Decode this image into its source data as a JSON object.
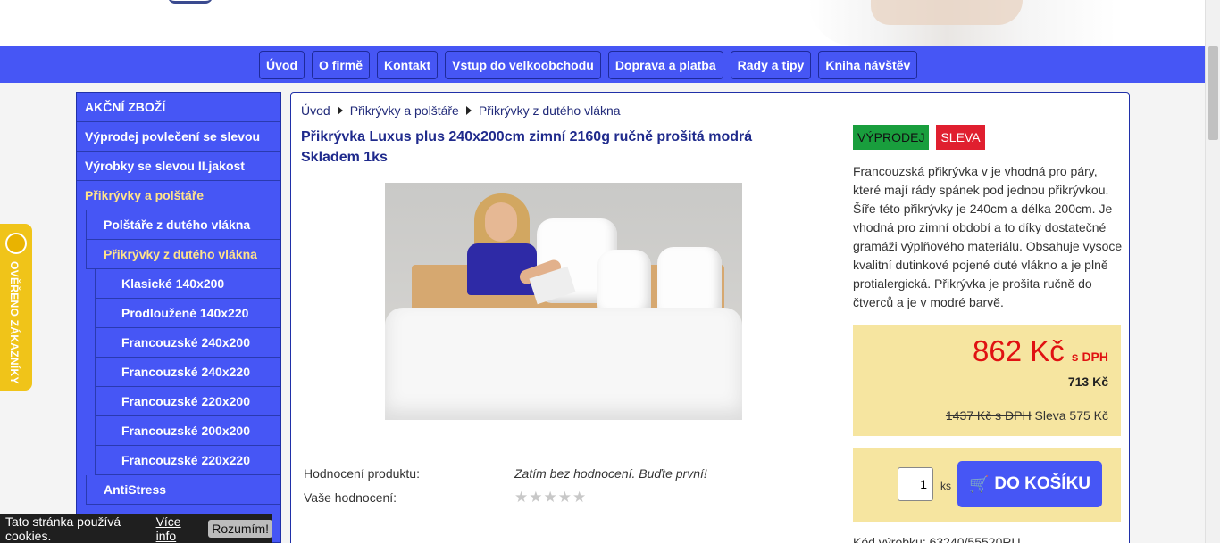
{
  "nav": [
    "Úvod",
    "O firmě",
    "Kontakt",
    "Vstup do velkoobchodu",
    "Doprava a platba",
    "Rady a tipy",
    "Kniha návštěv"
  ],
  "sidebar": [
    {
      "label": "AKČNÍ ZBOŽÍ",
      "level": 0,
      "active": false
    },
    {
      "label": "Výprodej povlečení se slevou",
      "level": 0,
      "active": false
    },
    {
      "label": "Výrobky se slevou II.jakost",
      "level": 0,
      "active": false
    },
    {
      "label": "Přikrývky a polštáře",
      "level": 0,
      "active": true
    },
    {
      "label": "Polštáře z dutého vlákna",
      "level": 1,
      "active": false
    },
    {
      "label": "Přikrývky z dutého vlákna",
      "level": 1,
      "active": true
    },
    {
      "label": "Klasické 140x200",
      "level": 2,
      "active": false
    },
    {
      "label": "Prodloužené 140x220",
      "level": 2,
      "active": false
    },
    {
      "label": "Francouzské 240x200",
      "level": 2,
      "active": false
    },
    {
      "label": "Francouzské 240x220",
      "level": 2,
      "active": false
    },
    {
      "label": "Francouzské 220x200",
      "level": 2,
      "active": false
    },
    {
      "label": "Francouzské 200x200",
      "level": 2,
      "active": false
    },
    {
      "label": "Francouzské 220x220",
      "level": 2,
      "active": false
    },
    {
      "label": "AntiStress",
      "level": 1,
      "active": false
    }
  ],
  "verified_badge": "OVĚŘENO ZÁKAZNÍKY",
  "cookie": {
    "text": "Tato stránka používá cookies.",
    "link": "Více info",
    "button": "Rozumím!"
  },
  "breadcrumb": [
    "Úvod",
    "Přikrývky a polštáře",
    "Přikrývky z dutého vlákna"
  ],
  "product": {
    "title": "Přikrývka Luxus plus 240x200cm zimní 2160g ručně prošitá modrá",
    "stock": "Skladem 1ks",
    "badges": {
      "sale": "VÝPRODEJ",
      "discount": "SLEVA"
    },
    "description": "Francouzská přikrývka v je vhodná pro páry, které mají rády spánek pod jednou přikrývkou. Šíře této přikrývky je 240cm a délka 200cm. Je vhodná pro zimní období a to díky dostatečné gramáži výplňového materiálu. Obsahuje vysoce kvalitní dutinkové pojené duté vlákno a je plně protialergická. Přikrývka je prošita ručně do čtverců a je v modré barvě.",
    "price": "862 Kč",
    "price_vat_label": "s DPH",
    "price_net": "713 Kč",
    "price_old": "1437 Kč s DPH",
    "price_saving": "Sleva 575 Kč",
    "quantity": "1",
    "quantity_unit": "ks",
    "cart_button": "DO KOŠÍKU",
    "code_label": "Kód výrobku: 63240/55520RU"
  },
  "rating": {
    "product_label": "Hodnocení produktu:",
    "product_value": "Zatím bez hodnocení. Buďte první!",
    "your_label": "Vaše hodnocení:",
    "stars": 5
  },
  "colors": {
    "brand_blue": "#4656f5",
    "price_red": "#e01212",
    "price_bg": "#f6e5a0",
    "sale_green": "#199e3d",
    "sale_red": "#e01f2f"
  }
}
